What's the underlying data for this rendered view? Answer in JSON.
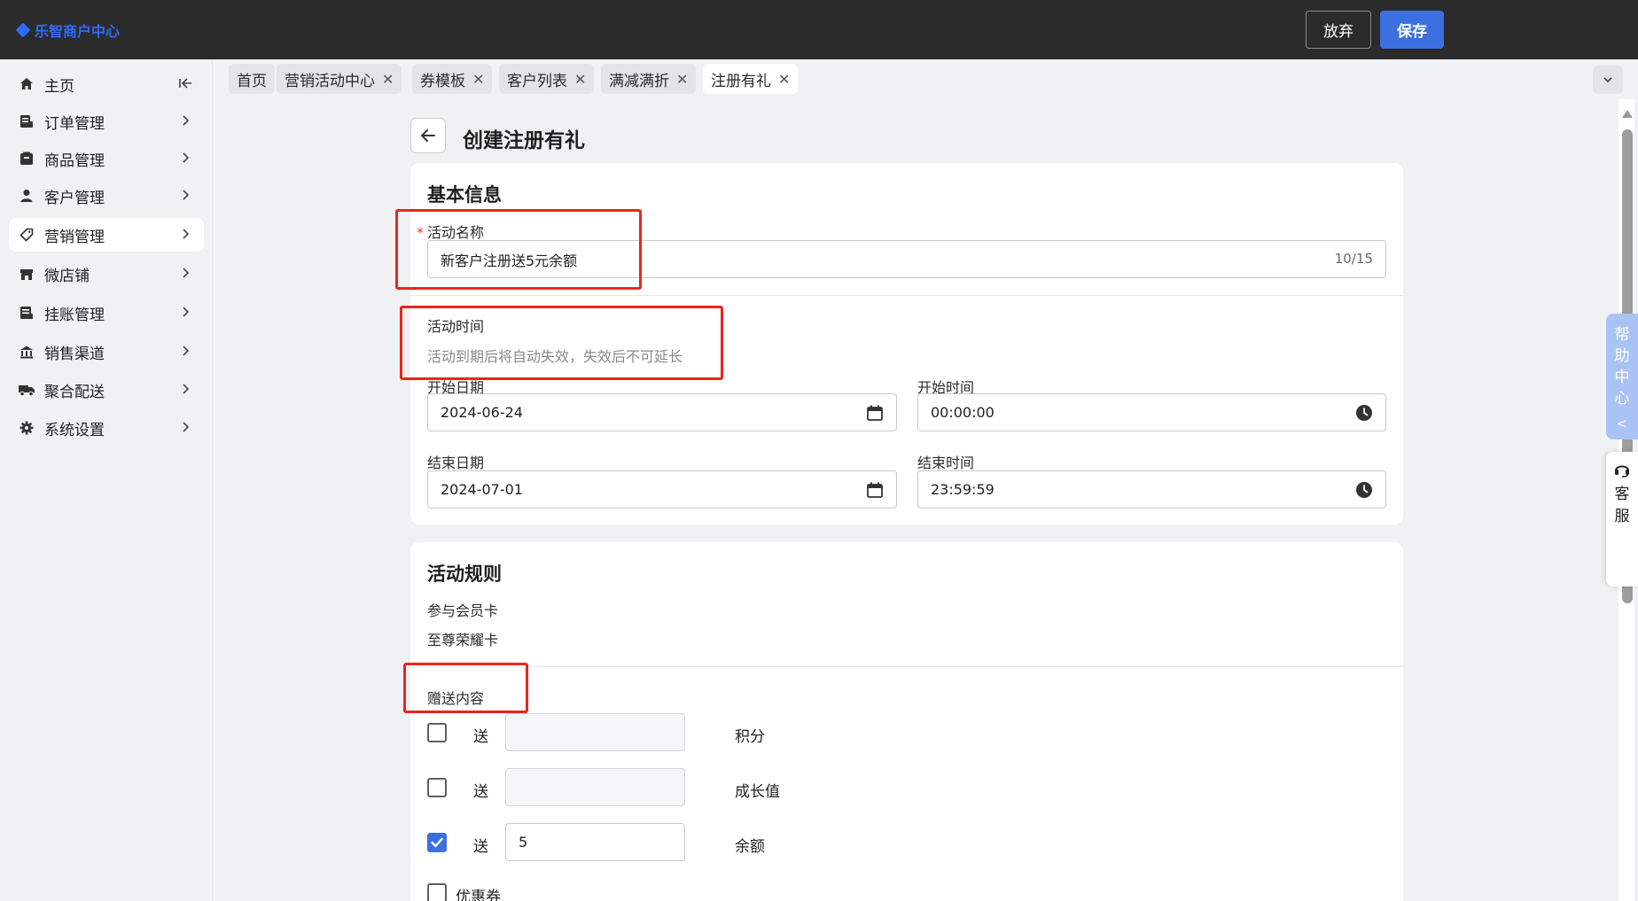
{
  "app": {
    "logo_text": "乐智商户中心"
  },
  "header": {
    "discard_label": "放弃",
    "save_label": "保存"
  },
  "sidebar": {
    "items": [
      {
        "label": "主页",
        "icon": "home-icon"
      },
      {
        "label": "订单管理",
        "icon": "order-icon"
      },
      {
        "label": "商品管理",
        "icon": "product-icon"
      },
      {
        "label": "客户管理",
        "icon": "customer-icon"
      },
      {
        "label": "营销管理",
        "icon": "tag-icon"
      },
      {
        "label": "微店铺",
        "icon": "store-icon"
      },
      {
        "label": "挂账管理",
        "icon": "credit-icon"
      },
      {
        "label": "销售渠道",
        "icon": "channel-icon"
      },
      {
        "label": "聚合配送",
        "icon": "delivery-icon"
      },
      {
        "label": "系统设置",
        "icon": "gear-icon"
      }
    ]
  },
  "tabs": [
    {
      "label": "首页"
    },
    {
      "label": "营销活动中心"
    },
    {
      "label": "券模板"
    },
    {
      "label": "客户列表"
    },
    {
      "label": "满减满折"
    },
    {
      "label": "注册有礼"
    }
  ],
  "page": {
    "title": "创建注册有礼"
  },
  "basic_info": {
    "title": "基本信息",
    "name_label": "活动名称",
    "name_value": "新客户注册送5元余额",
    "name_count": "10/15",
    "time_label": "活动时间",
    "time_help": "活动到期后将自动失效，失效后不可延长",
    "start_date_label": "开始日期",
    "start_date_value": "2024-06-24",
    "start_time_label": "开始时间",
    "start_time_value": "00:00:00",
    "end_date_label": "结束日期",
    "end_date_value": "2024-07-01",
    "end_time_label": "结束时间",
    "end_time_value": "23:59:59"
  },
  "rules": {
    "title": "活动规则",
    "member_card_label": "参与会员卡",
    "member_card_value": "至尊荣耀卡",
    "gift_label": "赠送内容",
    "gifts": [
      {
        "prefix": "送",
        "value": "",
        "unit": "积分",
        "checked": false
      },
      {
        "prefix": "送",
        "value": "",
        "unit": "成长值",
        "checked": false
      },
      {
        "prefix": "送",
        "value": "5",
        "unit": "余额",
        "checked": true
      }
    ],
    "coupon_label": "优惠券"
  },
  "side": {
    "help_center_chars": [
      "帮",
      "助",
      "中",
      "心"
    ],
    "help_center_arrow": "<",
    "kefu_chars": [
      "客",
      "服"
    ]
  },
  "colors": {
    "primary": "#3c6fe0",
    "topbar": "#2b2b2b",
    "highlight_box": "#e8261f"
  }
}
